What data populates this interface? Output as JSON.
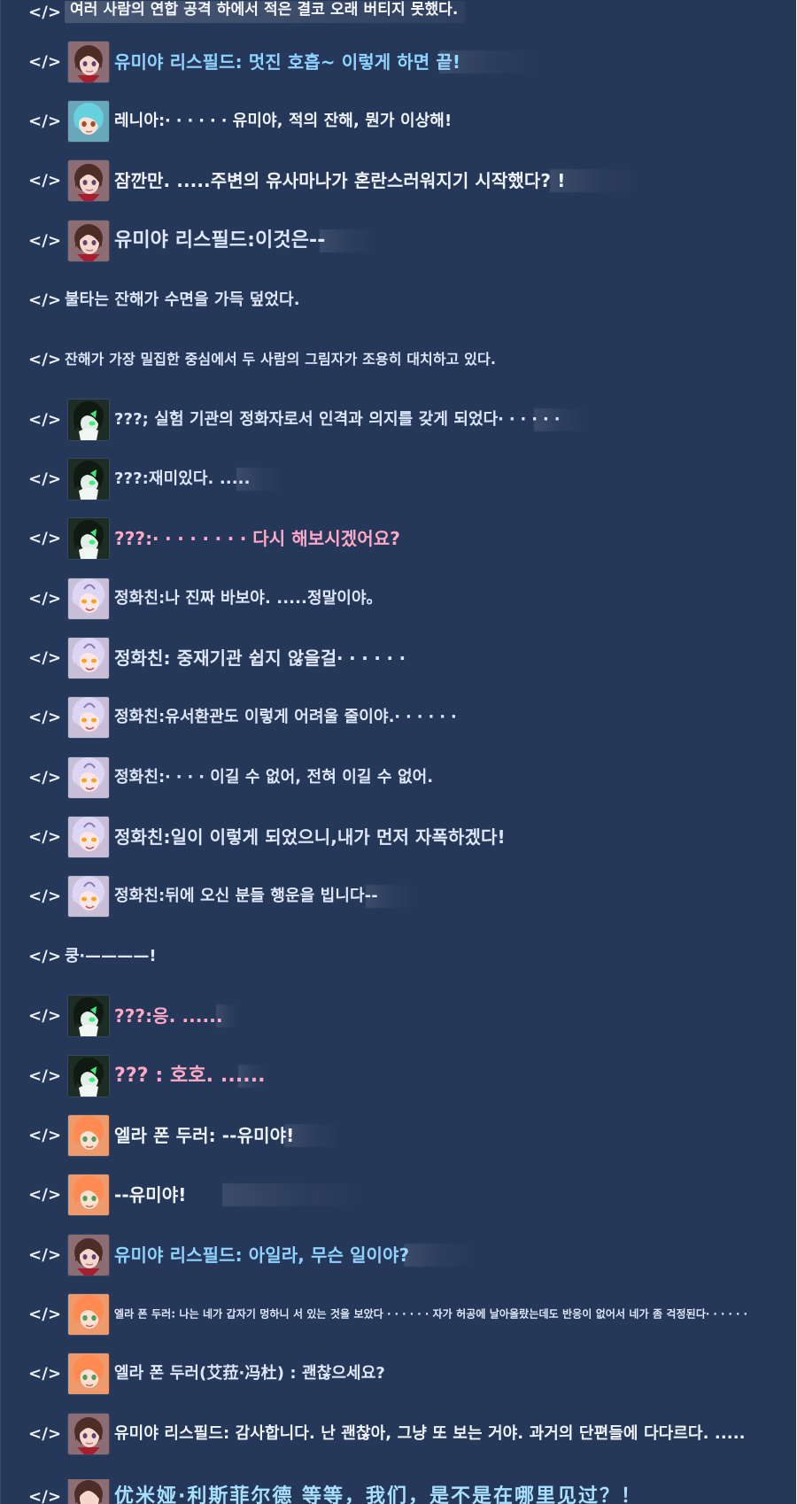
{
  "window": {
    "theme_colors": {
      "panel_bg": "#263859",
      "text": "#eef3ff",
      "blue_name": "#8fd3ff",
      "pink_name": "#ffa9c7"
    }
  },
  "chat": {
    "messages": [
      {
        "tag": "</>",
        "avatar": "",
        "text": "여러 사람의 연합 공격 하에서 적은 결코 오래 버티지 못했다."
      },
      {
        "tag": "</>",
        "avatar": "yumia-avatar",
        "text": "유미야 리스필드: 멋진 호흡~ 이렇게 하면 끝!"
      },
      {
        "tag": "</>",
        "avatar": "renia-avatar",
        "text": "레니아:‧ ‧ ‧ ‧ ‧ ‧ 유미야, 적의 잔해, 뭔가 이상해!"
      },
      {
        "tag": "</>",
        "avatar": "yumia-avatar",
        "text": "잠깐만. .....주변의 유사마나가 혼란스러워지기 시작했다? !"
      },
      {
        "tag": "</>",
        "avatar": "yumia-avatar",
        "text": "유미야 리스필드:이것은--"
      },
      {
        "tag": "</>",
        "avatar": "",
        "text": "불타는 잔해가 수면을 가득 덮었다."
      },
      {
        "tag": "</>",
        "avatar": "",
        "text": "잔해가 가장 밀집한 중심에서 두 사람의 그림자가 조용히 대치하고 있다."
      },
      {
        "tag": "</>",
        "avatar": "unknown-avatar",
        "text": "???; 실험 기관의 정화자로서 인격과 의지를 갖게 되었다‧ ‧ ‧ ‧ ‧ ‧"
      },
      {
        "tag": "</>",
        "avatar": "unknown-avatar",
        "text": "???:재미있다. ....."
      },
      {
        "tag": "</>",
        "avatar": "unknown-avatar",
        "text": "???:‧ ‧ ‧ ‧ ‧ ‧ ‧ ‧ 다시 해보시겠어요?"
      },
      {
        "tag": "</>",
        "avatar": "jeonghwachin-avatar",
        "text": "정화친:나 진짜 바보야. .....정말이야。"
      },
      {
        "tag": "</>",
        "avatar": "jeonghwachin-avatar",
        "text": "정화친: 중재기관 쉽지 않을걸‧ ‧ ‧ ‧ ‧ ‧"
      },
      {
        "tag": "</>",
        "avatar": "jeonghwachin-avatar",
        "text": "정화친:유서환관도 이렇게 어려울 줄이야.‧ ‧ ‧ ‧ ‧ ‧"
      },
      {
        "tag": "</>",
        "avatar": "jeonghwachin-avatar",
        "text": "정화친:‧ ‧ ‧ ‧ 이길 수 없어, 전혀 이길 수 없어."
      },
      {
        "tag": "</>",
        "avatar": "jeonghwachin-avatar",
        "text": "정화친:일이 이렇게 되었으니,내가 먼저 자폭하겠다!"
      },
      {
        "tag": "</>",
        "avatar": "jeonghwachin-avatar",
        "text": "정화친:뒤에 오신 분들 행운을 빕니다--"
      },
      {
        "tag": "</>",
        "avatar": "",
        "text": "쿵‧————!"
      },
      {
        "tag": "</>",
        "avatar": "unknown-avatar",
        "text": "???:응. ......"
      },
      {
        "tag": "</>",
        "avatar": "unknown-avatar",
        "text": "??? : 호호. ......"
      },
      {
        "tag": "</>",
        "avatar": "ella-avatar",
        "text": "엘라 폰 두러: --유미야!"
      },
      {
        "tag": "</>",
        "avatar": "ella-avatar",
        "text": "--유미야!"
      },
      {
        "tag": "</>",
        "avatar": "yumia-avatar",
        "text": "유미야 리스필드: 아일라, 무슨 일이야?"
      },
      {
        "tag": "</>",
        "avatar": "ella-avatar",
        "text": "엘라 폰 두러: 나는 네가 갑자기 멍하니 서 있는 것을 보았다 ‧ ‧ ‧ ‧ ‧ ‧ 자가 허공에 날아올랐는데도 반응이 없어서 네가 좀 걱정된다‧ ‧ ‧ ‧ ‧ ‧"
      },
      {
        "tag": "</>",
        "avatar": "ella-avatar",
        "text": "엘라 폰 두러(艾菈·冯杜) : 괜찮으세요?"
      },
      {
        "tag": "</>",
        "avatar": "yumia-avatar",
        "text": "유미야 리스필드: 감사합니다. 난 괜찮아, 그냥 또 보는 거야. 과거의 단편들에 다다르다. ....."
      },
      {
        "tag": "</>",
        "avatar": "yumia-avatar",
        "text": "优米娅·利斯菲尔德    等等，我们，是不是在哪里见过？！"
      }
    ]
  }
}
